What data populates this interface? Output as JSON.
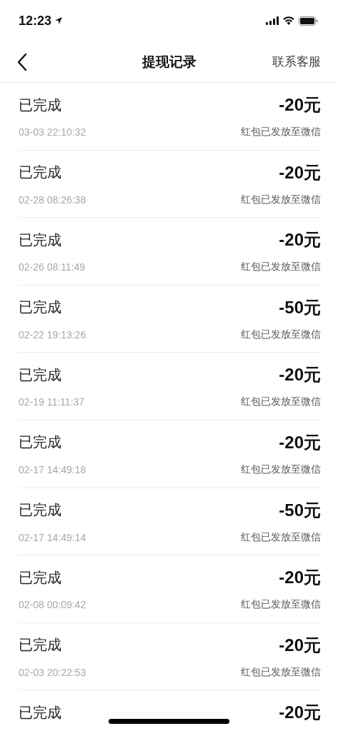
{
  "status_bar": {
    "time": "12:23"
  },
  "nav": {
    "title": "提现记录",
    "action": "联系客服"
  },
  "records": [
    {
      "status": "已完成",
      "amount": "-20元",
      "time": "03-03 22:10:32",
      "note": "红包已发放至微信"
    },
    {
      "status": "已完成",
      "amount": "-20元",
      "time": "02-28 08:26:38",
      "note": "红包已发放至微信"
    },
    {
      "status": "已完成",
      "amount": "-20元",
      "time": "02-26 08:11:49",
      "note": "红包已发放至微信"
    },
    {
      "status": "已完成",
      "amount": "-50元",
      "time": "02-22 19:13:26",
      "note": "红包已发放至微信"
    },
    {
      "status": "已完成",
      "amount": "-20元",
      "time": "02-19 11:11:37",
      "note": "红包已发放至微信"
    },
    {
      "status": "已完成",
      "amount": "-20元",
      "time": "02-17 14:49:18",
      "note": "红包已发放至微信"
    },
    {
      "status": "已完成",
      "amount": "-50元",
      "time": "02-17 14:49:14",
      "note": "红包已发放至微信"
    },
    {
      "status": "已完成",
      "amount": "-20元",
      "time": "02-08 00:09:42",
      "note": "红包已发放至微信"
    },
    {
      "status": "已完成",
      "amount": "-20元",
      "time": "02-03 20:22:53",
      "note": "红包已发放至微信"
    },
    {
      "status": "已完成",
      "amount": "-20元"
    }
  ]
}
